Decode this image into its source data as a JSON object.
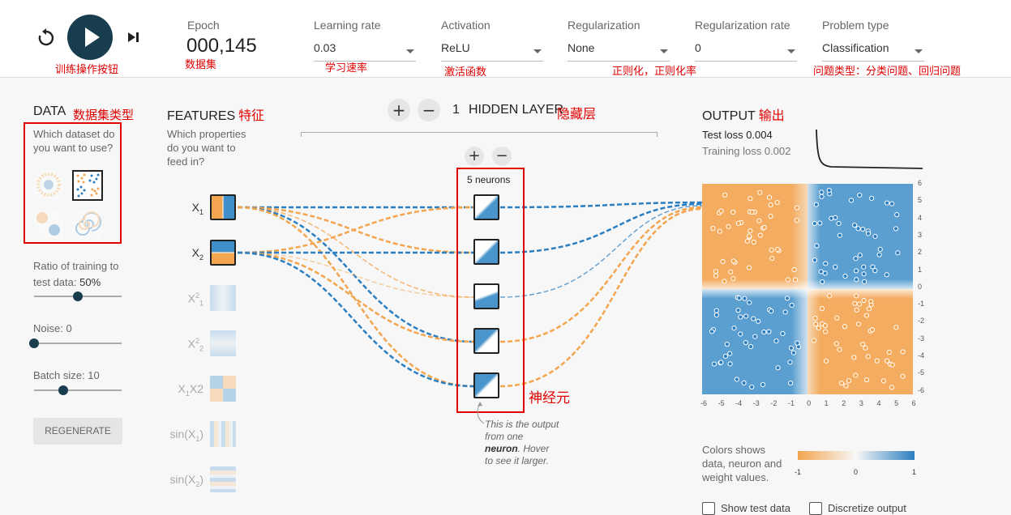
{
  "controls": {
    "reset_icon": "reset-icon",
    "play_icon": "play-icon",
    "step_icon": "step-icon",
    "epoch_label": "Epoch",
    "epoch_value": "000,145",
    "learning_rate_label": "Learning rate",
    "learning_rate_value": "0.03",
    "activation_label": "Activation",
    "activation_value": "ReLU",
    "regularization_label": "Regularization",
    "regularization_value": "None",
    "regularization_rate_label": "Regularization rate",
    "regularization_rate_value": "0",
    "problem_type_label": "Problem type",
    "problem_type_value": "Classification"
  },
  "annotations": {
    "training_buttons": "训练操作按钮",
    "dataset": "数据集",
    "learning_rate": "学习速率",
    "activation": "激活函数",
    "regularization": "正则化，正则化率",
    "problem_type": "问题类型：分类问题、回归问题",
    "dataset_type": "数据集类型",
    "features": "特征",
    "hidden_layer": "隐藏层",
    "output": "输出",
    "neurons": "神经元"
  },
  "data_panel": {
    "title": "DATA",
    "question": "Which dataset do you want to use?",
    "ratio_label": "Ratio of training to test data:",
    "ratio_value": "50%",
    "ratio_fraction": 0.5,
    "noise_label": "Noise:",
    "noise_value": "0",
    "noise_fraction": 0,
    "batch_label": "Batch size:",
    "batch_value": "10",
    "batch_fraction": 0.33,
    "regenerate_label": "REGENERATE"
  },
  "features_panel": {
    "title": "FEATURES",
    "question": "Which properties do you want to feed in?",
    "features": [
      {
        "label": "X",
        "sub": "1",
        "sup": "",
        "suffix": "",
        "active": true
      },
      {
        "label": "X",
        "sub": "2",
        "sup": "",
        "suffix": "",
        "active": true
      },
      {
        "label": "X",
        "sub": "1",
        "sup": "2",
        "suffix": "",
        "active": false
      },
      {
        "label": "X",
        "sub": "2",
        "sup": "2",
        "suffix": "",
        "active": false
      },
      {
        "label": "X",
        "sub": "1",
        "sup": "",
        "suffix": "X2",
        "active": false
      },
      {
        "label": "sin(X",
        "sub": "1",
        "sup": "",
        "suffix": ")",
        "active": false
      },
      {
        "label": "sin(X",
        "sub": "2",
        "sup": "",
        "suffix": ")",
        "active": false
      }
    ]
  },
  "network": {
    "add_layer": "+",
    "remove_layer": "−",
    "layer_count": "1",
    "hidden_layers_label": "HIDDEN LAYER",
    "add_neuron": "+",
    "remove_neuron": "−",
    "neurons_label": "5 neurons",
    "neuron_count": 5,
    "hint_text_1": "This is the output",
    "hint_text_2": "from one",
    "hint_bold": "neuron",
    "hint_text_3": ". Hover",
    "hint_text_4": "to see it larger."
  },
  "output_panel": {
    "title": "OUTPUT",
    "test_loss_label": "Test loss",
    "test_loss_value": "0.004",
    "training_loss_label": "Training loss",
    "training_loss_value": "0.002",
    "y_ticks": [
      "6",
      "5",
      "4",
      "3",
      "2",
      "1",
      "0",
      "-1",
      "-2",
      "-3",
      "-4",
      "-5",
      "-6"
    ],
    "x_ticks": [
      "-6",
      "-5",
      "-4",
      "-3",
      "-2",
      "-1",
      "0",
      "1",
      "2",
      "3",
      "4",
      "5",
      "6"
    ],
    "legend_text": "Colors shows data, neuron and weight values.",
    "legend_min": "-1",
    "legend_mid": "0",
    "legend_max": "1",
    "show_test_label": "Show test data",
    "discretize_label": "Discretize output"
  },
  "colors": {
    "positive": "#2b7ec0",
    "negative": "#f3a54f",
    "dark": "#183d4e",
    "annotation": "#e00000"
  }
}
